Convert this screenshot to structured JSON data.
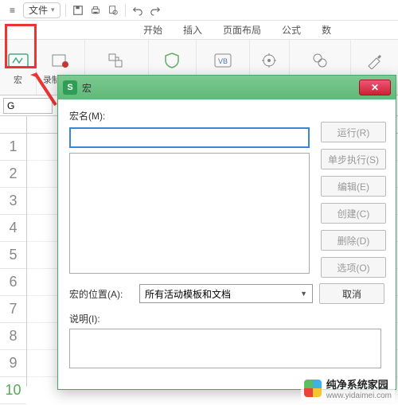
{
  "menubar": {
    "menu_icon": "≡",
    "file_label": "文件",
    "file_caret": "▾"
  },
  "tabs": {
    "begin": "开始",
    "insert": "插入",
    "layout": "页面布局",
    "formula": "公式",
    "data": "数"
  },
  "ribbon": {
    "macro": "宏",
    "record": "录制新宏",
    "relative": "使用相对引用",
    "security": "宏安全性",
    "vbe": "VB 编辑器",
    "addins": "加载项",
    "com": "COM 加载项",
    "design": "设计模式"
  },
  "formula_bar": {
    "namebox": "G"
  },
  "rows": [
    "1",
    "2",
    "3",
    "4",
    "5",
    "6",
    "7",
    "8",
    "9",
    "10"
  ],
  "dialog": {
    "title": "宏",
    "macro_name_label": "宏名(M):",
    "macro_name_value": "",
    "location_label": "宏的位置(A):",
    "location_value": "所有活动模板和文档",
    "desc_label": "说明(I):",
    "buttons": {
      "run": "运行(R)",
      "step": "单步执行(S)",
      "edit": "编辑(E)",
      "create": "创建(C)",
      "del": "删除(D)",
      "options": "选项(O)",
      "cancel": "取消"
    }
  },
  "watermark": {
    "title": "纯净系统家园",
    "url": "www.yidaimei.com"
  }
}
